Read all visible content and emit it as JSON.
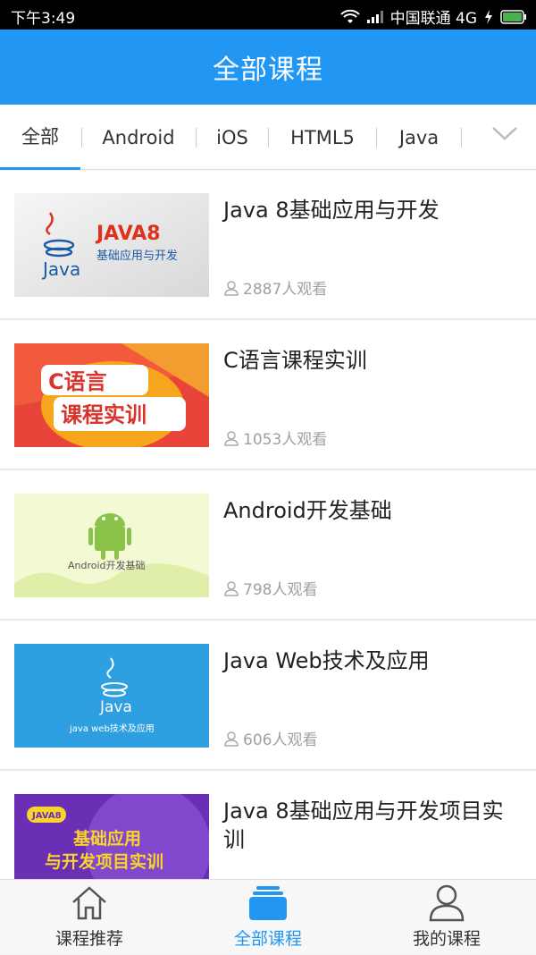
{
  "status": {
    "time": "下午3:49",
    "carrier": "中国联通 4G"
  },
  "header": {
    "title": "全部课程"
  },
  "tabs": [
    "全部",
    "Android",
    "iOS",
    "HTML5",
    "Java"
  ],
  "courses": [
    {
      "title": "Java 8基础应用与开发",
      "views": "2887人观看",
      "thumb_text": [
        "JAVA8",
        "基础应用与开发",
        "Java"
      ]
    },
    {
      "title": "C语言课程实训",
      "views": "1053人观看",
      "thumb_text": [
        "C语言",
        "课程实训"
      ]
    },
    {
      "title": "Android开发基础",
      "views": "798人观看",
      "thumb_text": [
        "Android开发基础"
      ]
    },
    {
      "title": "Java Web技术及应用",
      "views": "606人观看",
      "thumb_text": [
        "Java",
        "java web技术及应用"
      ]
    },
    {
      "title": "Java 8基础应用与开发项目实训",
      "views": "",
      "thumb_text": [
        "JAVA8",
        "基础应用",
        "与开发项目实训"
      ]
    }
  ],
  "nav": [
    {
      "label": "课程推荐",
      "icon": "home-icon"
    },
    {
      "label": "全部课程",
      "icon": "courses-icon"
    },
    {
      "label": "我的课程",
      "icon": "user-icon"
    }
  ],
  "colors": {
    "primary": "#2196f3"
  }
}
